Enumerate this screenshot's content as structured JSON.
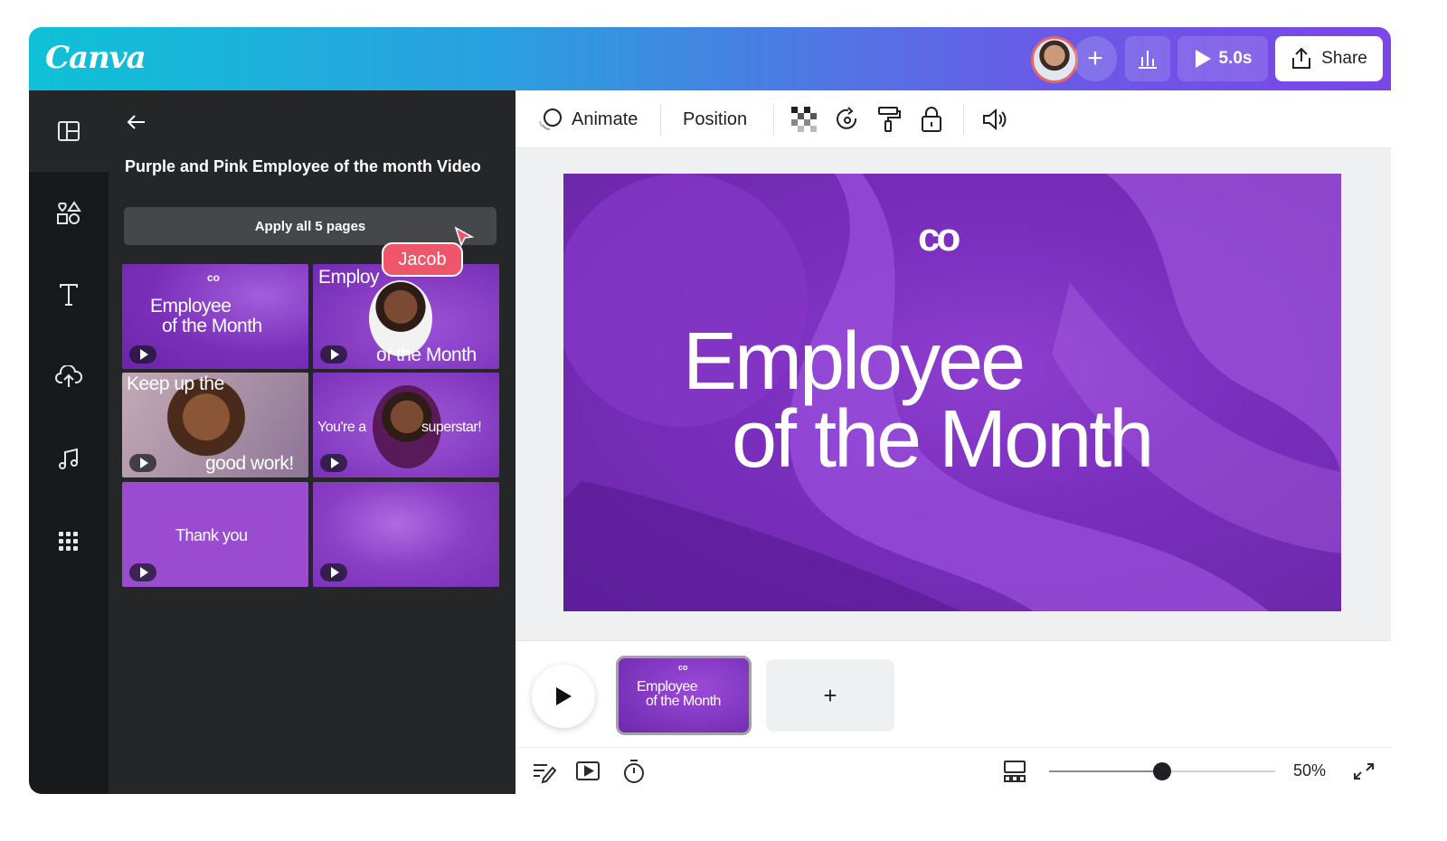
{
  "app": {
    "logo": "Canva"
  },
  "topbar": {
    "play_duration": "5.0s",
    "share_label": "Share"
  },
  "panel": {
    "title": "Purple and Pink Employee of the month Video",
    "apply_label": "Apply all 5 pages",
    "collaborator_tag": "Jacob",
    "thumbnails": [
      {
        "logo": "co",
        "line1": "Employee",
        "line2": "of the Month"
      },
      {
        "line1": "Employ",
        "line2": "of the Month"
      },
      {
        "line1": "Keep up the",
        "line2": "good work!"
      },
      {
        "line1": "You're a",
        "line2": "superstar!"
      },
      {
        "line1": "Thank you"
      },
      {}
    ]
  },
  "toolbar": {
    "animate_label": "Animate",
    "position_label": "Position"
  },
  "canvas": {
    "logo": "co",
    "title_line1": "Employee",
    "title_line2": "of the Month"
  },
  "timeline": {
    "add_label": "+",
    "thumb_logo": "co",
    "thumb_line1": "Employee",
    "thumb_line2": "of the Month"
  },
  "bottom": {
    "zoom_label": "50%",
    "zoom_level": 0.5
  },
  "colors": {
    "brand_gradient_start": "#0fc1d6",
    "brand_gradient_end": "#7c45e8",
    "canvas_purple": "#7b2fbe",
    "collab_tag": "#f0566b"
  }
}
